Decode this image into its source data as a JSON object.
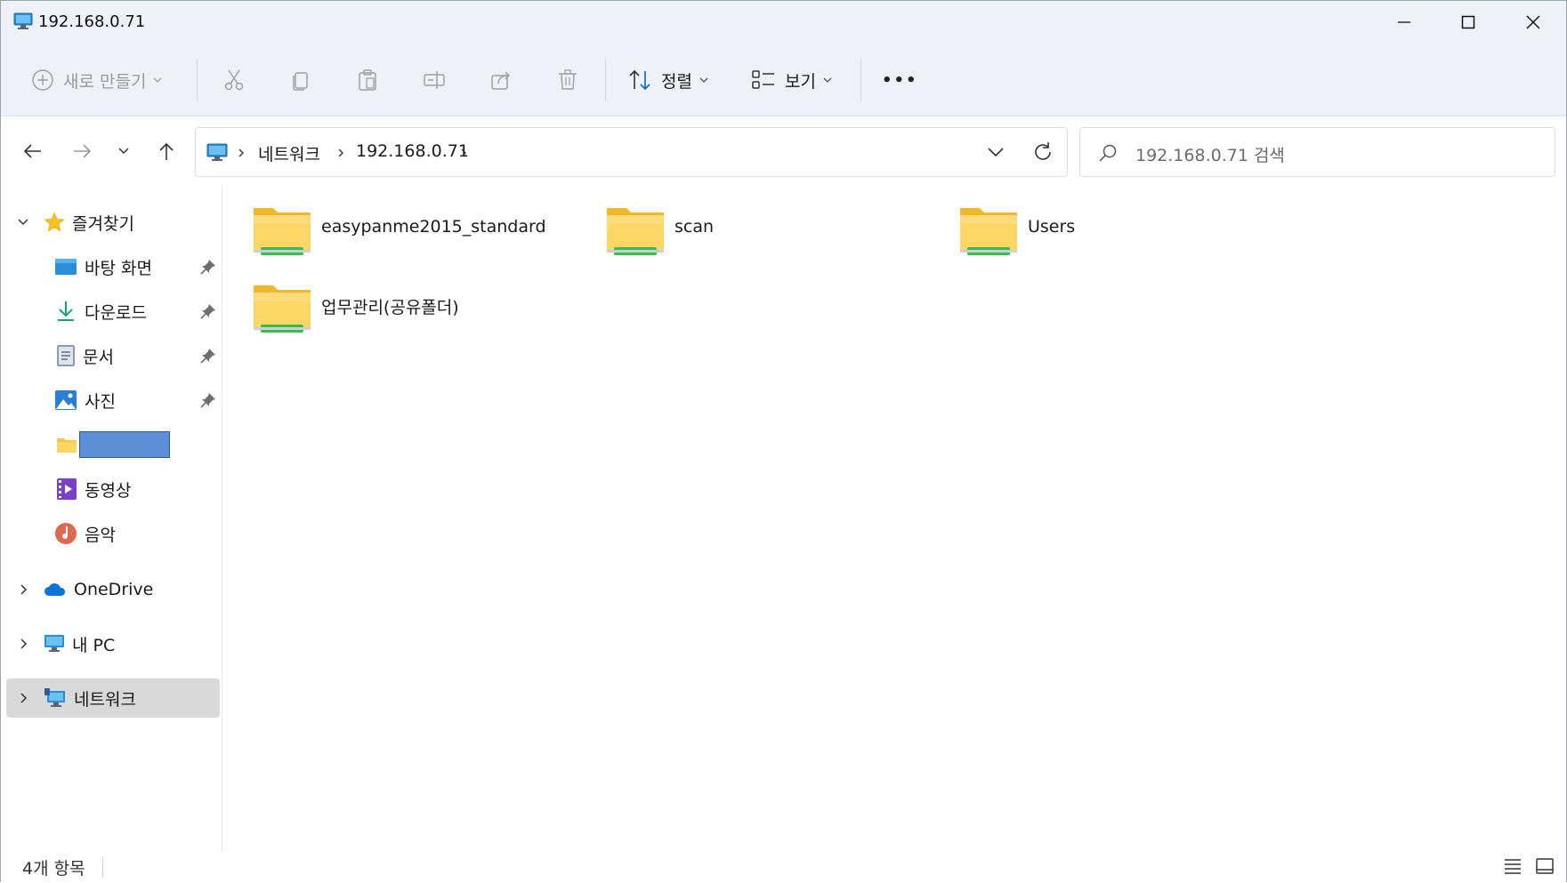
{
  "window": {
    "title": "192.168.0.71"
  },
  "toolbar": {
    "new_label": "새로 만들기",
    "sort_label": "정렬",
    "view_label": "보기",
    "more_label": "•••"
  },
  "address": {
    "crumbs": [
      "네트워크",
      "192.168.0.71"
    ],
    "search_placeholder": "192.168.0.71 검색"
  },
  "sidebar": {
    "favorites_label": "즐겨찾기",
    "items": [
      {
        "label": "바탕 화면",
        "icon": "desktop-icon",
        "pinned": true
      },
      {
        "label": "다운로드",
        "icon": "download-icon",
        "pinned": true
      },
      {
        "label": "문서",
        "icon": "document-icon",
        "pinned": true
      },
      {
        "label": "사진",
        "icon": "pictures-icon",
        "pinned": true
      },
      {
        "label": "",
        "icon": "folder-icon",
        "pinned": false
      },
      {
        "label": "동영상",
        "icon": "video-icon",
        "pinned": false
      },
      {
        "label": "음악",
        "icon": "music-icon",
        "pinned": false
      }
    ],
    "onedrive_label": "OneDrive",
    "thispc_label": "내 PC",
    "network_label": "네트워크"
  },
  "folders": [
    {
      "name": "easypanme2015_standard"
    },
    {
      "name": "scan"
    },
    {
      "name": "Users"
    },
    {
      "name": "업무관리(공유폴더)"
    }
  ],
  "status": {
    "count_text": "4개 항목"
  },
  "colors": {
    "folder_yellow": "#f8c93e",
    "share_green": "#3dba4e",
    "accent_blue": "#0067c0",
    "selected_bg": "#d9d9d9",
    "redaction_blue": "#5b8fd6"
  }
}
